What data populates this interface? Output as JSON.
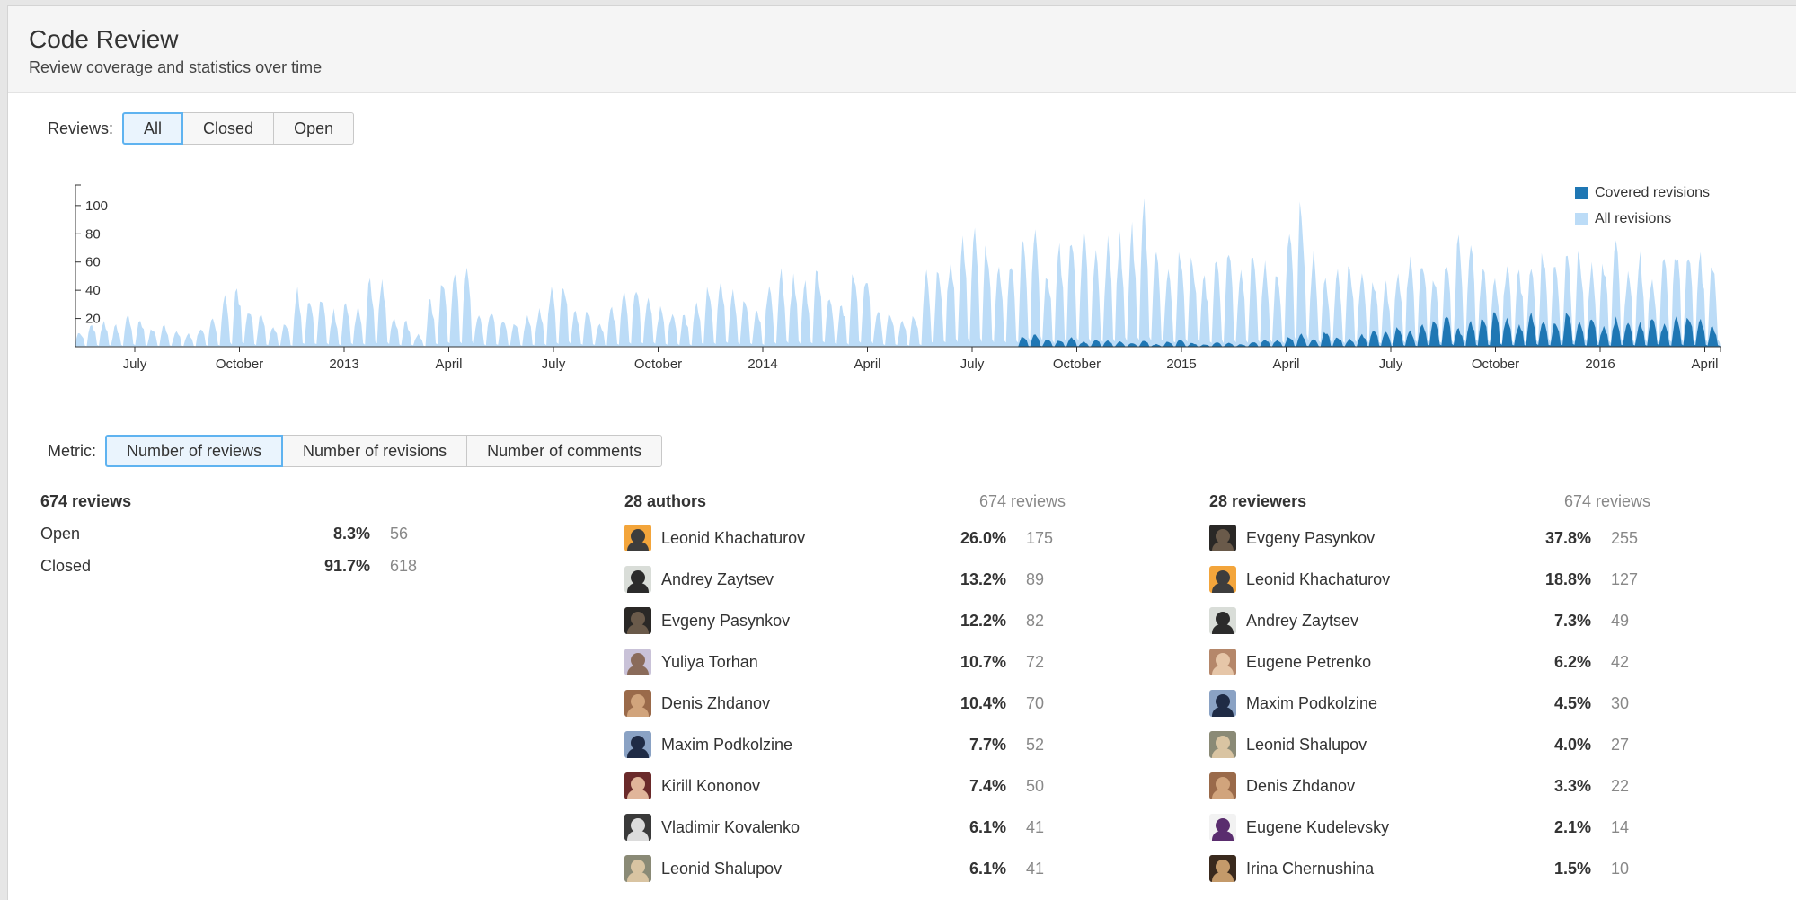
{
  "header": {
    "title": "Code Review",
    "subtitle": "Review coverage and statistics over time"
  },
  "reviews_filter": {
    "label": "Reviews:",
    "options": [
      "All",
      "Closed",
      "Open"
    ],
    "selected": "All"
  },
  "metric_filter": {
    "label": "Metric:",
    "options": [
      "Number of reviews",
      "Number of revisions",
      "Number of comments"
    ],
    "selected": "Number of reviews"
  },
  "chart_data": {
    "type": "area",
    "series": [
      {
        "name": "Covered revisions",
        "color": "#1f77b4"
      },
      {
        "name": "All revisions",
        "color": "#bcdcf7"
      }
    ],
    "y_ticks": [
      "20",
      "40",
      "60",
      "80",
      "100"
    ],
    "ylim": [
      0,
      112
    ],
    "x_ticks": [
      "July",
      "October",
      "2013",
      "April",
      "July",
      "October",
      "2014",
      "April",
      "July",
      "October",
      "2015",
      "April",
      "July",
      "October",
      "2016",
      "April"
    ],
    "x_tick_index": [
      0,
      1,
      2,
      3,
      4,
      5,
      6,
      7,
      8,
      9,
      10,
      11,
      12,
      13,
      14,
      15
    ],
    "all_revisions_weekly_peaks": [
      12,
      18,
      20,
      16,
      25,
      22,
      14,
      17,
      12,
      10,
      15,
      22,
      40,
      48,
      30,
      25,
      18,
      20,
      45,
      40,
      38,
      28,
      36,
      30,
      50,
      48,
      22,
      20,
      10,
      38,
      52,
      60,
      66,
      25,
      30,
      22,
      18,
      24,
      28,
      46,
      52,
      30,
      28,
      20,
      32,
      45,
      52,
      42,
      30,
      28,
      25,
      38,
      48,
      56,
      42,
      38,
      30,
      50,
      60,
      55,
      48,
      62,
      40,
      36,
      58,
      60,
      30,
      28,
      20,
      26,
      55,
      62,
      72,
      85,
      88,
      80,
      70,
      72,
      90,
      95,
      62,
      76,
      85,
      92,
      75,
      82,
      88,
      98,
      112,
      82,
      60,
      78,
      72,
      55,
      66,
      78,
      60,
      72,
      66,
      58,
      92,
      115,
      70,
      56,
      60,
      70,
      60,
      52,
      48,
      62,
      75,
      70,
      58,
      65,
      82,
      84,
      68,
      50,
      66,
      60,
      70,
      76,
      64,
      72,
      80,
      62,
      66,
      85,
      60,
      75,
      58,
      70,
      80,
      76,
      72,
      66
    ],
    "covered_revisions_weekly_peaks": [
      0,
      0,
      0,
      0,
      0,
      0,
      0,
      0,
      0,
      0,
      0,
      0,
      0,
      0,
      0,
      0,
      0,
      0,
      0,
      0,
      0,
      0,
      0,
      0,
      0,
      0,
      0,
      0,
      0,
      0,
      0,
      0,
      0,
      0,
      0,
      0,
      0,
      0,
      0,
      0,
      0,
      0,
      0,
      0,
      0,
      0,
      0,
      0,
      0,
      0,
      0,
      0,
      0,
      0,
      0,
      0,
      0,
      0,
      0,
      0,
      0,
      0,
      0,
      0,
      0,
      0,
      0,
      0,
      0,
      0,
      0,
      0,
      0,
      0,
      0,
      0,
      0,
      0,
      8,
      10,
      6,
      5,
      8,
      4,
      6,
      5,
      4,
      3,
      5,
      2,
      4,
      6,
      3,
      2,
      4,
      3,
      2,
      4,
      6,
      5,
      8,
      10,
      6,
      12,
      8,
      6,
      10,
      14,
      12,
      16,
      12,
      18,
      22,
      26,
      14,
      20,
      24,
      30,
      22,
      18,
      26,
      22,
      20,
      28,
      18,
      24,
      16,
      22,
      20,
      18,
      26,
      18,
      22,
      24,
      20,
      16
    ]
  },
  "summary": {
    "title": "674 reviews",
    "rows": [
      {
        "name": "Open",
        "pct": "8.3%",
        "count": "56"
      },
      {
        "name": "Closed",
        "pct": "91.7%",
        "count": "618"
      }
    ]
  },
  "authors": {
    "title": "28 authors",
    "total": "674 reviews",
    "rows": [
      {
        "name": "Leonid Khachaturov",
        "pct": "26.0%",
        "count": "175",
        "avatar_bg": "#f3a53b",
        "avatar_fg": "#3d3d3d"
      },
      {
        "name": "Andrey Zaytsev",
        "pct": "13.2%",
        "count": "89",
        "avatar_bg": "#d9ddd8",
        "avatar_fg": "#2b2b2b"
      },
      {
        "name": "Evgeny Pasynkov",
        "pct": "12.2%",
        "count": "82",
        "avatar_bg": "#2a2826",
        "avatar_fg": "#6a5a4a"
      },
      {
        "name": "Yuliya Torhan",
        "pct": "10.7%",
        "count": "72",
        "avatar_bg": "#c9c2d8",
        "avatar_fg": "#8a6b5a"
      },
      {
        "name": "Denis Zhdanov",
        "pct": "10.4%",
        "count": "70",
        "avatar_bg": "#9a6a4a",
        "avatar_fg": "#d1a47c"
      },
      {
        "name": "Maxim Podkolzine",
        "pct": "7.7%",
        "count": "52",
        "avatar_bg": "#8aa2c4",
        "avatar_fg": "#1f2b45"
      },
      {
        "name": "Kirill Kononov",
        "pct": "7.4%",
        "count": "50",
        "avatar_bg": "#6a2a2a",
        "avatar_fg": "#e0b59a"
      },
      {
        "name": "Vladimir Kovalenko",
        "pct": "6.1%",
        "count": "41",
        "avatar_bg": "#3a3a3a",
        "avatar_fg": "#dcdcdc"
      },
      {
        "name": "Leonid Shalupov",
        "pct": "6.1%",
        "count": "41",
        "avatar_bg": "#8a8a76",
        "avatar_fg": "#d9c4a2"
      }
    ]
  },
  "reviewers": {
    "title": "28 reviewers",
    "total": "674 reviews",
    "rows": [
      {
        "name": "Evgeny Pasynkov",
        "pct": "37.8%",
        "count": "255",
        "avatar_bg": "#2a2826",
        "avatar_fg": "#6a5a4a"
      },
      {
        "name": "Leonid Khachaturov",
        "pct": "18.8%",
        "count": "127",
        "avatar_bg": "#f3a53b",
        "avatar_fg": "#3d3d3d"
      },
      {
        "name": "Andrey Zaytsev",
        "pct": "7.3%",
        "count": "49",
        "avatar_bg": "#d9ddd8",
        "avatar_fg": "#2b2b2b"
      },
      {
        "name": "Eugene Petrenko",
        "pct": "6.2%",
        "count": "42",
        "avatar_bg": "#b5876a",
        "avatar_fg": "#e6c6a8"
      },
      {
        "name": "Maxim Podkolzine",
        "pct": "4.5%",
        "count": "30",
        "avatar_bg": "#8aa2c4",
        "avatar_fg": "#1f2b45"
      },
      {
        "name": "Leonid Shalupov",
        "pct": "4.0%",
        "count": "27",
        "avatar_bg": "#8a8a76",
        "avatar_fg": "#d9c4a2"
      },
      {
        "name": "Denis Zhdanov",
        "pct": "3.3%",
        "count": "22",
        "avatar_bg": "#9a6a4a",
        "avatar_fg": "#d1a47c"
      },
      {
        "name": "Eugene Kudelevsky",
        "pct": "2.1%",
        "count": "14",
        "avatar_bg": "#f2f2f2",
        "avatar_fg": "#5a2d6e"
      },
      {
        "name": "Irina Chernushina",
        "pct": "1.5%",
        "count": "10",
        "avatar_bg": "#3a2a1e",
        "avatar_fg": "#c49a6a"
      }
    ]
  }
}
